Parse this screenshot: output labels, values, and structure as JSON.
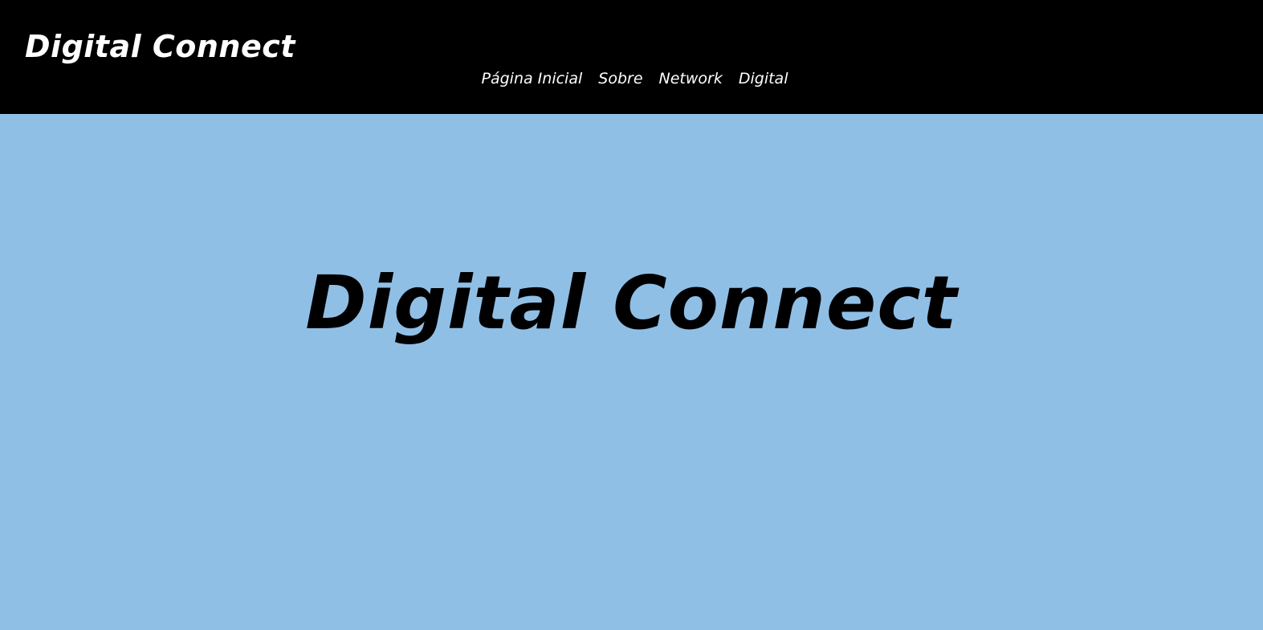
{
  "header": {
    "brand": "Digital Connect",
    "nav": [
      {
        "label": "Página Inicial"
      },
      {
        "label": "Sobre"
      },
      {
        "label": "Network"
      },
      {
        "label": "Digital"
      }
    ]
  },
  "hero": {
    "title": "Digital Connect"
  },
  "colors": {
    "header_bg": "#000000",
    "page_bg": "#90bfe6",
    "nav_text": "#ffffff",
    "hero_text": "#000000"
  }
}
